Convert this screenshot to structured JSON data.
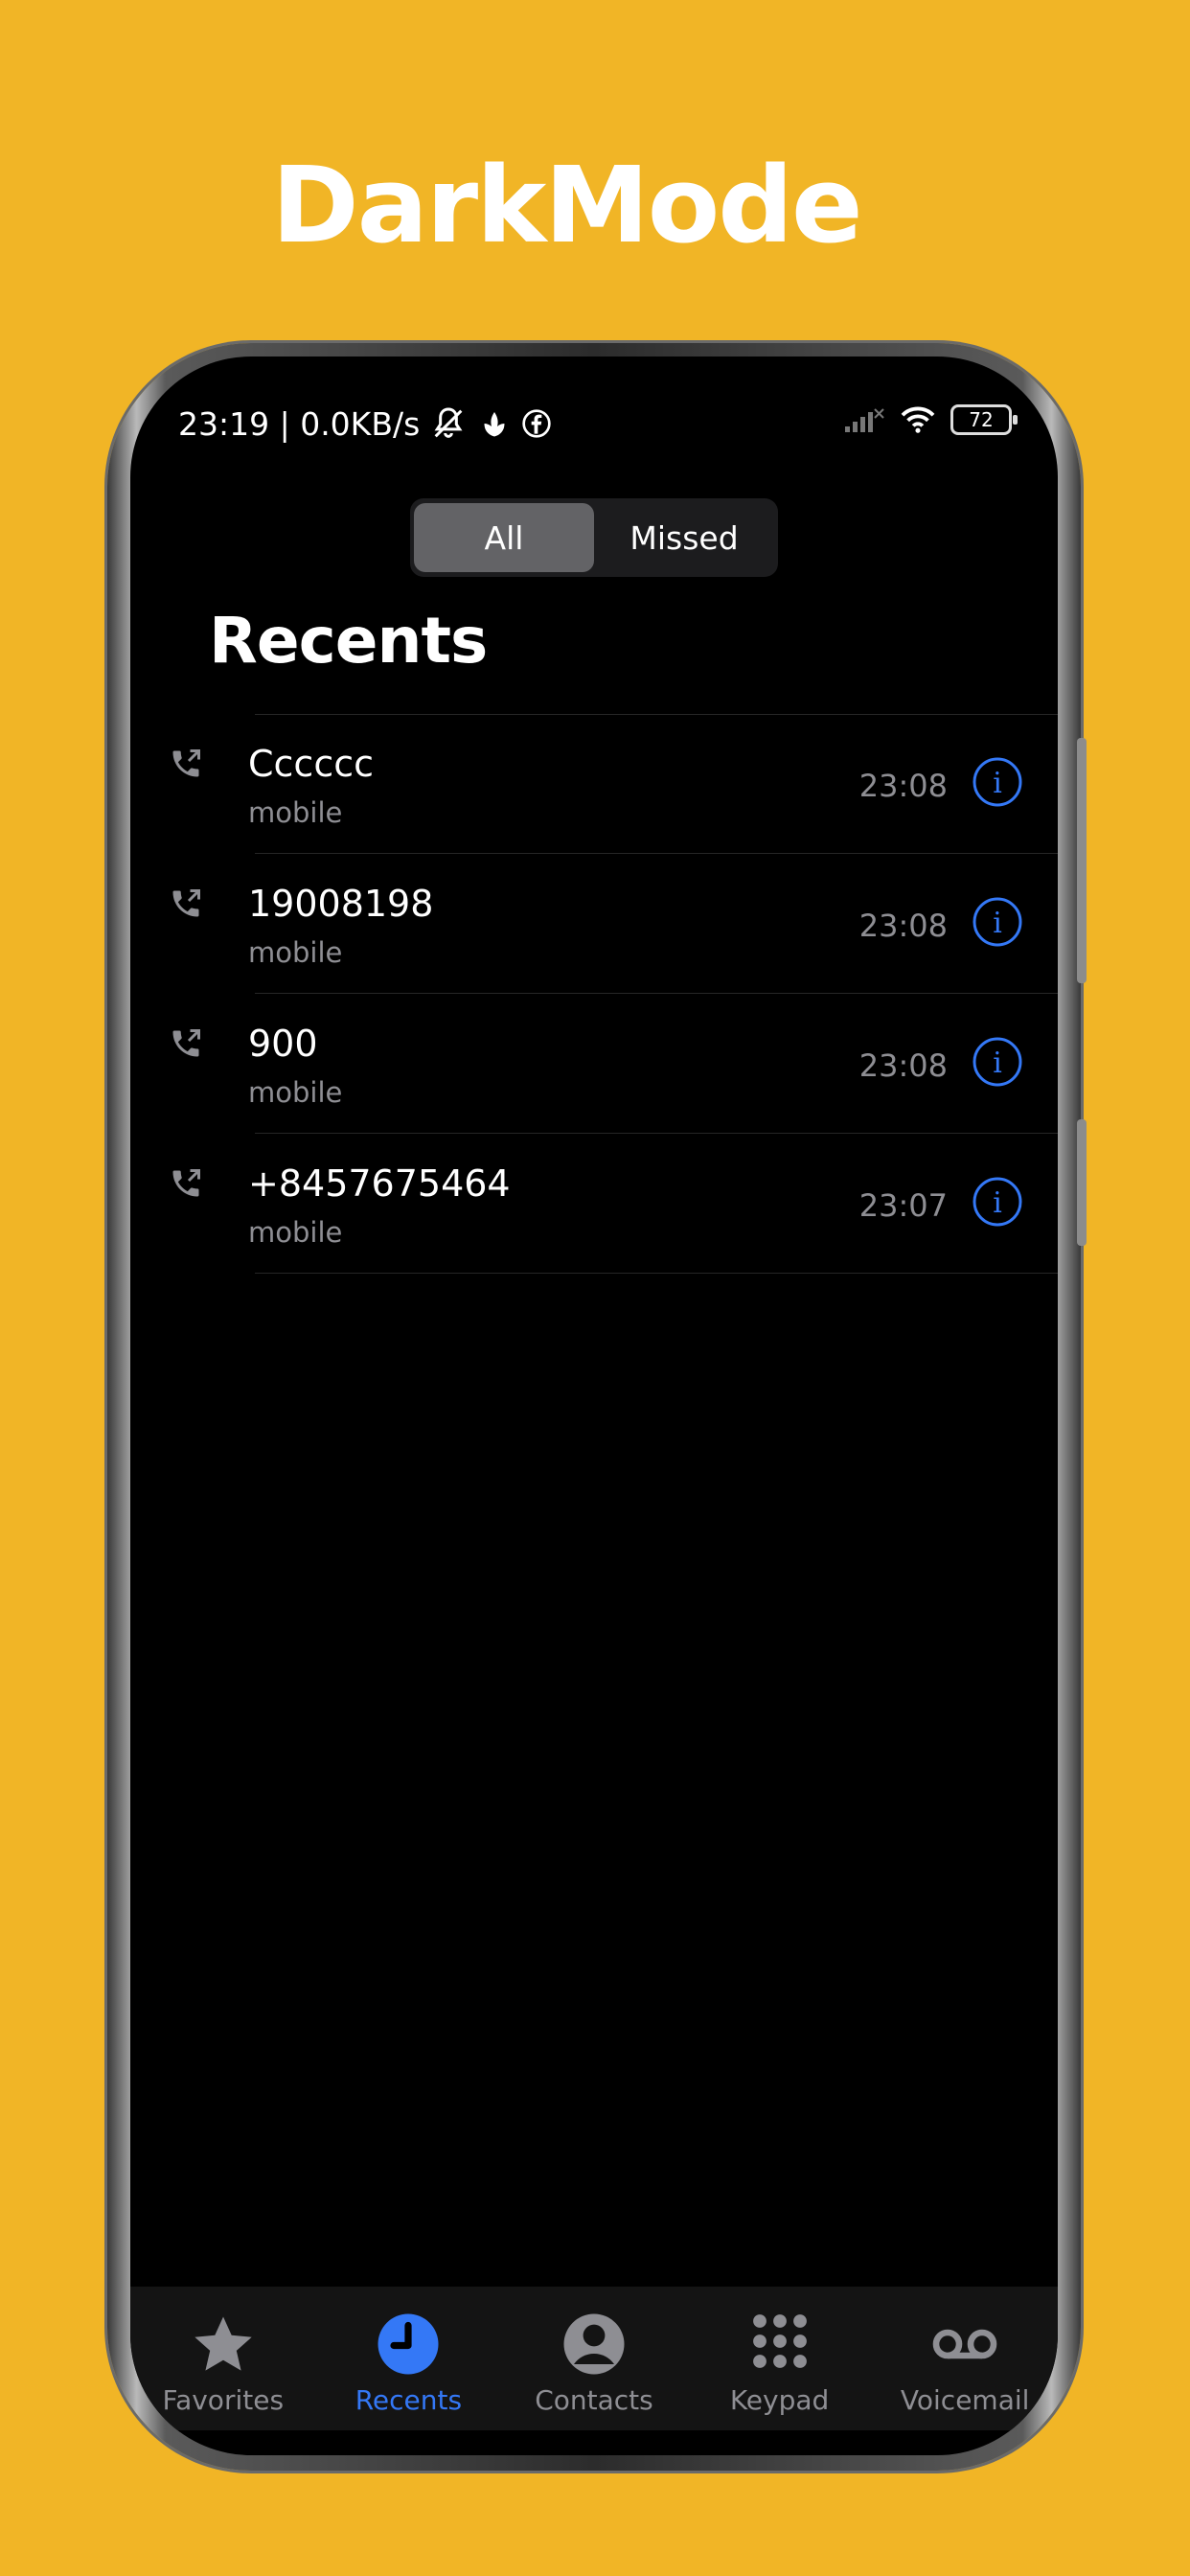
{
  "promo": {
    "title": "DarkMode"
  },
  "status_bar": {
    "time_speed": "23:19 | 0.0KB/s",
    "battery": "72"
  },
  "segmented": {
    "all_label": "All",
    "missed_label": "Missed",
    "selected": "All"
  },
  "page": {
    "title": "Recents"
  },
  "calls": [
    {
      "name": "Cccccc",
      "type": "mobile",
      "time": "23:08"
    },
    {
      "name": "19008198",
      "type": "mobile",
      "time": "23:08"
    },
    {
      "name": "900",
      "type": "mobile",
      "time": "23:08"
    },
    {
      "name": "+8457675464",
      "type": "mobile",
      "time": "23:07"
    }
  ],
  "tabs": [
    {
      "label": "Favorites",
      "icon": "star-icon"
    },
    {
      "label": "Recents",
      "icon": "clock-icon",
      "active": true
    },
    {
      "label": "Contacts",
      "icon": "person-circle-icon"
    },
    {
      "label": "Keypad",
      "icon": "keypad-icon"
    },
    {
      "label": "Voicemail",
      "icon": "voicemail-icon"
    }
  ],
  "colors": {
    "background": "#F1B526",
    "accent": "#3478F6",
    "screen": "#000000"
  }
}
